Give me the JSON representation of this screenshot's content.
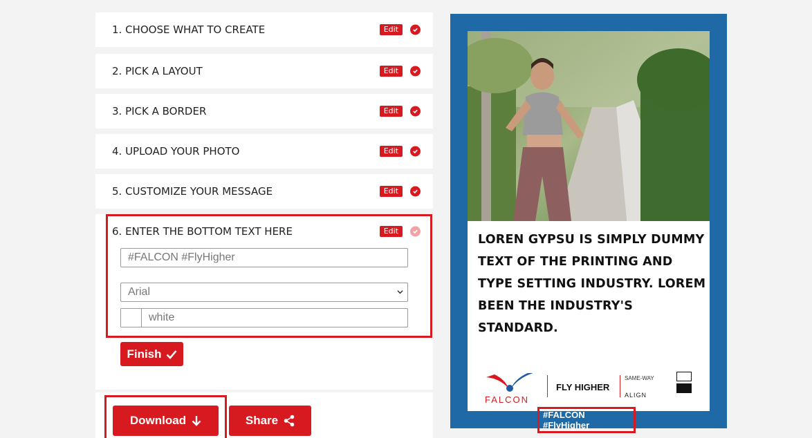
{
  "steps": [
    {
      "label": "1. CHOOSE WHAT TO CREATE",
      "edit": "Edit"
    },
    {
      "label": "2. PICK A LAYOUT",
      "edit": "Edit"
    },
    {
      "label": "3. PICK A BORDER",
      "edit": "Edit"
    },
    {
      "label": "4. UPLOAD YOUR PHOTO",
      "edit": "Edit"
    },
    {
      "label": "5. CUSTOMIZE YOUR MESSAGE",
      "edit": "Edit"
    },
    {
      "label": "6. ENTER THE BOTTOM TEXT HERE",
      "edit": "Edit"
    }
  ],
  "bottom_text": {
    "text_placeholder": "#FALCON #FlyHigher",
    "font_selected": "Arial",
    "color_value": "white"
  },
  "buttons": {
    "finish": "Finish",
    "download": "Download",
    "share": "Share"
  },
  "preview": {
    "message": "LOREN GYPSU IS SIMPLY DUMMY TEXT OF THE PRINTING AND TYPE SETTING INDUSTRY. LOREM BEEN THE INDUSTRY'S STANDARD.",
    "hashtag": "#FALCON #FlyHigher",
    "logos": {
      "falcon": "FALCON",
      "fly_higher": "FLY HIGHER",
      "same_way": "SAME-WAY",
      "align": "ALIGN"
    }
  },
  "colors": {
    "accent": "#d71920",
    "frame": "#1f6aa6"
  }
}
